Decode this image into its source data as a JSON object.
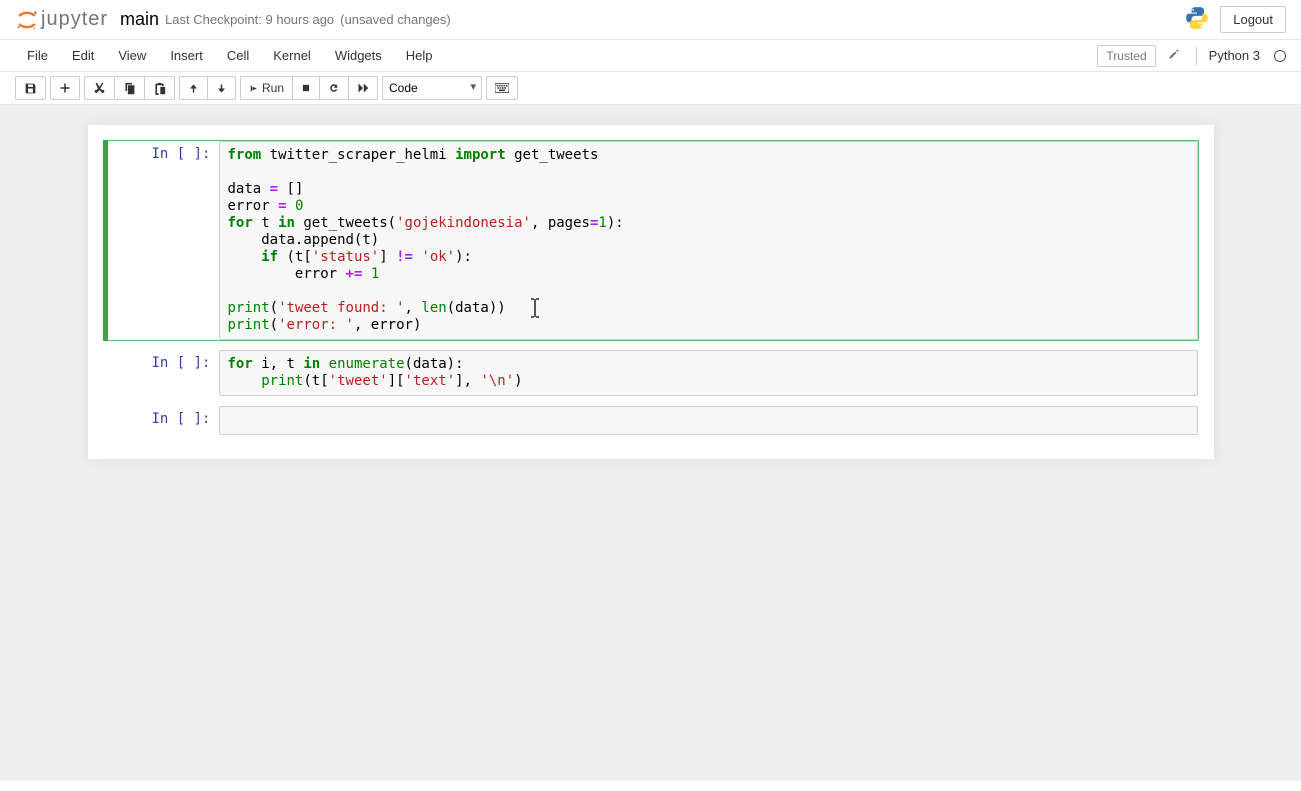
{
  "header": {
    "logo_text": "jupyter",
    "notebook_name": "main",
    "checkpoint": "Last Checkpoint: 9 hours ago",
    "unsaved": "(unsaved changes)",
    "logout": "Logout"
  },
  "menubar": {
    "items": [
      "File",
      "Edit",
      "View",
      "Insert",
      "Cell",
      "Kernel",
      "Widgets",
      "Help"
    ],
    "trusted": "Trusted",
    "kernel": "Python 3"
  },
  "toolbar": {
    "run_label": "Run",
    "cell_type": "Code"
  },
  "cells": [
    {
      "prompt": "In [ ]:",
      "code_tokens": [
        {
          "c": "kw",
          "t": "from"
        },
        {
          "t": " twitter_scraper_helmi "
        },
        {
          "c": "kw",
          "t": "import"
        },
        {
          "t": " get_tweets\n"
        },
        {
          "t": "\n"
        },
        {
          "t": "data "
        },
        {
          "c": "op",
          "t": "="
        },
        {
          "t": " []\n"
        },
        {
          "t": "error "
        },
        {
          "c": "op",
          "t": "="
        },
        {
          "t": " "
        },
        {
          "c": "num",
          "t": "0"
        },
        {
          "t": "\n"
        },
        {
          "c": "kw",
          "t": "for"
        },
        {
          "t": " t "
        },
        {
          "c": "kw",
          "t": "in"
        },
        {
          "t": " get_tweets("
        },
        {
          "c": "str",
          "t": "'gojekindonesia'"
        },
        {
          "t": ", pages"
        },
        {
          "c": "op",
          "t": "="
        },
        {
          "c": "num",
          "t": "1"
        },
        {
          "t": "):\n"
        },
        {
          "t": "    data.append(t)\n"
        },
        {
          "t": "    "
        },
        {
          "c": "kw",
          "t": "if"
        },
        {
          "t": " (t["
        },
        {
          "c": "str",
          "t": "'status'"
        },
        {
          "t": "] "
        },
        {
          "c": "op",
          "t": "!="
        },
        {
          "t": " "
        },
        {
          "c": "str",
          "t": "'ok'"
        },
        {
          "t": "):\n"
        },
        {
          "t": "        error "
        },
        {
          "c": "op",
          "t": "+="
        },
        {
          "t": " "
        },
        {
          "c": "num",
          "t": "1"
        },
        {
          "t": "\n"
        },
        {
          "t": "\n"
        },
        {
          "c": "bi",
          "t": "print"
        },
        {
          "t": "("
        },
        {
          "c": "str",
          "t": "'tweet found: '"
        },
        {
          "t": ", "
        },
        {
          "c": "bi",
          "t": "len"
        },
        {
          "t": "(data))\n"
        },
        {
          "c": "bi",
          "t": "print"
        },
        {
          "t": "("
        },
        {
          "c": "str",
          "t": "'error: '"
        },
        {
          "t": ", error)"
        }
      ],
      "selected": true
    },
    {
      "prompt": "In [ ]:",
      "code_tokens": [
        {
          "c": "kw",
          "t": "for"
        },
        {
          "t": " i, t "
        },
        {
          "c": "kw",
          "t": "in"
        },
        {
          "t": " "
        },
        {
          "c": "bi",
          "t": "enumerate"
        },
        {
          "t": "(data):\n"
        },
        {
          "t": "    "
        },
        {
          "c": "bi",
          "t": "print"
        },
        {
          "t": "(t["
        },
        {
          "c": "str",
          "t": "'tweet'"
        },
        {
          "t": "]["
        },
        {
          "c": "str",
          "t": "'text'"
        },
        {
          "t": "], "
        },
        {
          "c": "str",
          "t": "'\\n'"
        },
        {
          "t": ")"
        }
      ],
      "selected": false
    },
    {
      "prompt": "In [ ]:",
      "code_tokens": [
        {
          "t": " "
        }
      ],
      "selected": false
    }
  ]
}
